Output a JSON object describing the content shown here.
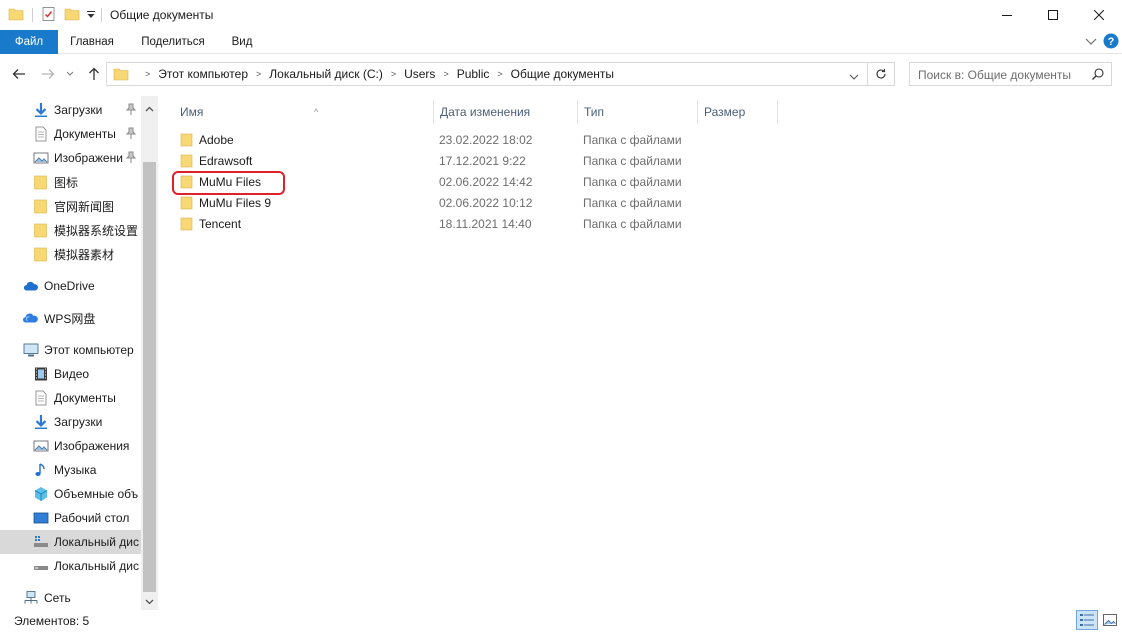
{
  "window": {
    "title": "Общие документы",
    "minimize_label": "─",
    "maximize_label": "☐",
    "close_label": "✕"
  },
  "ribbon": {
    "tabs": [
      "Файл",
      "Главная",
      "Поделиться",
      "Вид"
    ]
  },
  "address": {
    "crumbs": [
      "Этот компьютер",
      "Локальный диск (C:)",
      "Users",
      "Public",
      "Общие документы"
    ],
    "separator": ">"
  },
  "search": {
    "placeholder": "Поиск в: Общие документы"
  },
  "sidebar": {
    "items": [
      {
        "label": "Загрузки",
        "icon": "download-icon",
        "pinned": true
      },
      {
        "label": "Документы",
        "icon": "documents-icon",
        "pinned": true
      },
      {
        "label": "Изображени",
        "icon": "pictures-icon",
        "pinned": true
      },
      {
        "label": "图标",
        "icon": "folder-icon"
      },
      {
        "label": "官网新闻图",
        "icon": "folder-icon"
      },
      {
        "label": "模拟器系统设置",
        "icon": "folder-icon"
      },
      {
        "label": "模拟器素材",
        "icon": "folder-icon"
      },
      {
        "label": "OneDrive",
        "icon": "onedrive-icon"
      },
      {
        "label": "WPS网盘",
        "icon": "wps-cloud-icon"
      },
      {
        "label": "Этот компьютер",
        "icon": "this-pc-icon"
      },
      {
        "label": "Видео",
        "icon": "video-icon"
      },
      {
        "label": "Документы",
        "icon": "documents-icon"
      },
      {
        "label": "Загрузки",
        "icon": "download-icon"
      },
      {
        "label": "Изображения",
        "icon": "pictures-icon"
      },
      {
        "label": "Музыка",
        "icon": "music-icon"
      },
      {
        "label": "Объемные объ",
        "icon": "3d-objects-icon"
      },
      {
        "label": "Рабочий стол",
        "icon": "desktop-icon"
      },
      {
        "label": "Локальный дис",
        "icon": "local-disk-icon",
        "selected": true
      },
      {
        "label": "Локальный дис",
        "icon": "local-disk-icon"
      },
      {
        "label": "Сеть",
        "icon": "network-icon"
      }
    ]
  },
  "columns": {
    "name": "Имя",
    "date": "Дата изменения",
    "type": "Тип",
    "size": "Размер"
  },
  "files": [
    {
      "name": "Adobe",
      "date": "23.02.2022 18:02",
      "type": "Папка с файлами"
    },
    {
      "name": "Edrawsoft",
      "date": "17.12.2021 9:22",
      "type": "Папка с файлами"
    },
    {
      "name": "MuMu Files",
      "date": "02.06.2022 14:42",
      "type": "Папка с файлами",
      "highlighted": true
    },
    {
      "name": "MuMu Files 9",
      "date": "02.06.2022 10:12",
      "type": "Папка с файлами"
    },
    {
      "name": "Tencent",
      "date": "18.11.2021 14:40",
      "type": "Папка с файлами"
    }
  ],
  "status": {
    "items_count": "Элементов: 5"
  },
  "colors": {
    "accent": "#1979ca",
    "highlight_border": "#e2202b",
    "folder": "#f8d775"
  }
}
